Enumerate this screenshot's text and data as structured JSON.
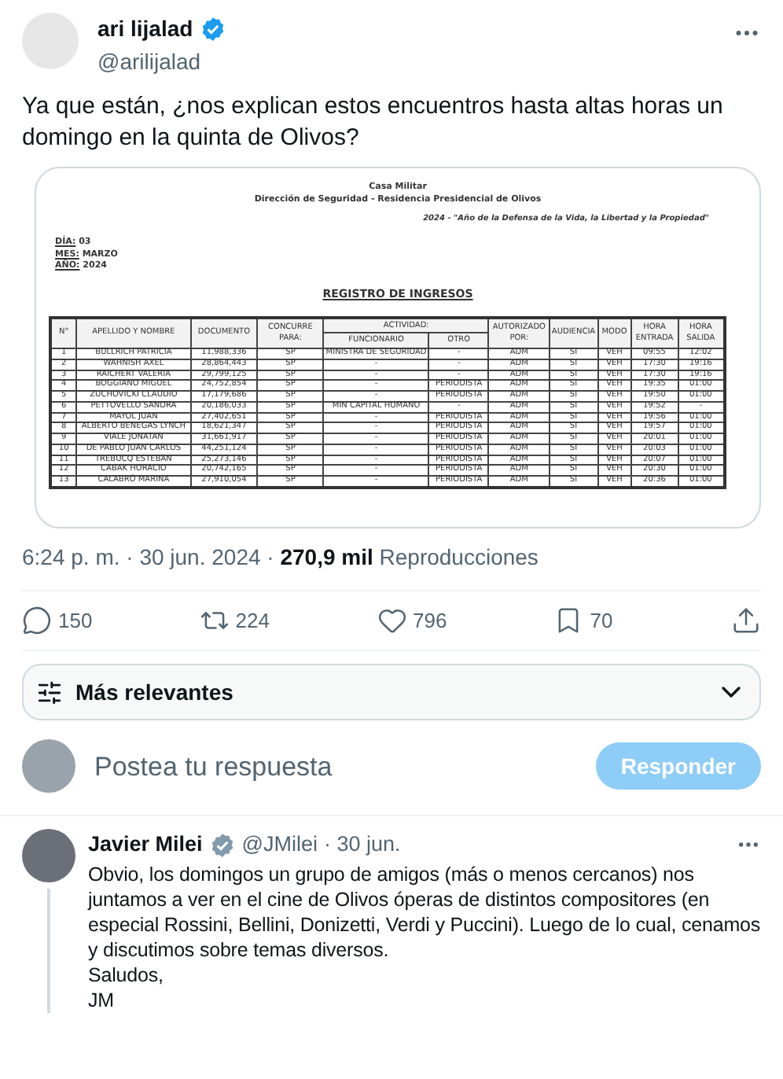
{
  "post": {
    "author": {
      "name": "ari lijalad",
      "handle": "@arilijalad",
      "verified": true
    },
    "text": "Ya que están, ¿nos explican estos encuentros hasta altas horas un domingo en la quinta de Olivos?",
    "document": {
      "header": [
        "Casa Militar",
        "Dirección de Seguridad - Residencia Presidencial de Olivos"
      ],
      "motto": "2024 - \"Año de la Defensa de la Vida, la Libertad y la Propiedad\"",
      "date_fields": [
        {
          "label": "DÍA:",
          "value": "03"
        },
        {
          "label": "MES:",
          "value": "MARZO"
        },
        {
          "label": "AÑO:",
          "value": "2024"
        }
      ],
      "title": "REGISTRO DE INGRESOS",
      "table": {
        "columns": [
          "N°",
          "APELLIDO Y NOMBRE",
          "DOCUMENTO",
          "CONCURRE PARA:",
          "FUNCIONARIO",
          "OTRO",
          "AUTORIZADO POR:",
          "AUDIENCIA",
          "MODO",
          "HORA ENTRADA",
          "HORA SALIDA"
        ],
        "group_header": "ACTIVIDAD:",
        "rows": [
          [
            "1",
            "BULLRICH PATRICIA",
            "11,988,336",
            "SP",
            "MINISTRA DE SEGURIDAD",
            "-",
            "ADM",
            "SI",
            "VEH",
            "09:55",
            "12:02"
          ],
          [
            "2",
            "WAHNISH AXEL",
            "28,864,443",
            "SP",
            "-",
            "-",
            "ADM",
            "SI",
            "VEH",
            "17:30",
            "19:16"
          ],
          [
            "3",
            "RAICHERT VALERIA",
            "29,799,125",
            "SP",
            "-",
            "-",
            "ADM",
            "SI",
            "VEH",
            "17:30",
            "19:16"
          ],
          [
            "4",
            "BOGGIANO MIGUEL",
            "24,752,854",
            "SP",
            "-",
            "PERIODISTA",
            "ADM",
            "SI",
            "VEH",
            "19:35",
            "01:00"
          ],
          [
            "5",
            "ZUCHOVICKI CLAUDIO",
            "17,179,686",
            "SP",
            "-",
            "PERIODISTA",
            "ADM",
            "SI",
            "VEH",
            "19:50",
            "01:00"
          ],
          [
            "6",
            "PETTOVELLO SANDRA",
            "20,186,033",
            "SP",
            "MIN CAPITAL HUMANO",
            "-",
            "ADM",
            "SI",
            "VEH",
            "19:52",
            "-"
          ],
          [
            "7",
            "MAYOL JUAN",
            "27,402,651",
            "SP",
            "-",
            "PERIODISTA",
            "ADM",
            "SI",
            "VEH",
            "19:56",
            "01:00"
          ],
          [
            "8",
            "ALBERTO BENEGAS LYNCH",
            "18,621,347",
            "SP",
            "-",
            "PERIODISTA",
            "ADM",
            "SI",
            "VEH",
            "19:57",
            "01:00"
          ],
          [
            "9",
            "VIALE JONATAN",
            "31,661,917",
            "SP",
            "-",
            "PERIODISTA",
            "ADM",
            "SI",
            "VEH",
            "20:01",
            "01:00"
          ],
          [
            "10",
            "DE PABLO JUAN CARLOS",
            "44,251,124",
            "SP",
            "-",
            "PERIODISTA",
            "ADM",
            "SI",
            "VEH",
            "20:03",
            "01:00"
          ],
          [
            "11",
            "TREBUCQ ESTEBAN",
            "25,273,146",
            "SP",
            "-",
            "PERIODISTA",
            "ADM",
            "SI",
            "VEH",
            "20:07",
            "01:00"
          ],
          [
            "12",
            "CABAK HORACIO",
            "20,742,165",
            "SP",
            "-",
            "PERIODISTA",
            "ADM",
            "SI",
            "VEH",
            "20:30",
            "01:00"
          ],
          [
            "13",
            "CALABRÓ MARINA",
            "27,910,054",
            "SP",
            "-",
            "PERIODISTA",
            "ADM",
            "SI",
            "VEH",
            "20:36",
            "01:00"
          ]
        ]
      }
    },
    "time": "6:24 p. m. · 30 jun. 2024 · ",
    "views": "270,9 mil",
    "views_label": " Reproducciones",
    "actions": [
      {
        "kind": "reply",
        "count": "150"
      },
      {
        "kind": "repost",
        "count": "224"
      },
      {
        "kind": "like",
        "count": "796"
      },
      {
        "kind": "bookmark",
        "count": "70"
      },
      {
        "kind": "share"
      }
    ]
  },
  "sort": {
    "label": "Más relevantes"
  },
  "composer": {
    "placeholder": "Postea tu respuesta",
    "button": "Responder",
    "disabled": true
  },
  "reply": {
    "author": {
      "name": "Javier Milei",
      "handle": "@JMilei",
      "verified": true
    },
    "time": "· 30 jun.",
    "lines": [
      "Obvio, los domingos un grupo de amigos (más o menos cercanos) nos juntamos a ver en el cine de Olivos óperas de distintos compositores (en especial Rossini, Bellini, Donizetti, Verdi y Puccini). Luego de lo cual, cenamos y discutimos sobre temas diversos.",
      "Saludos,",
      "JM"
    ]
  }
}
